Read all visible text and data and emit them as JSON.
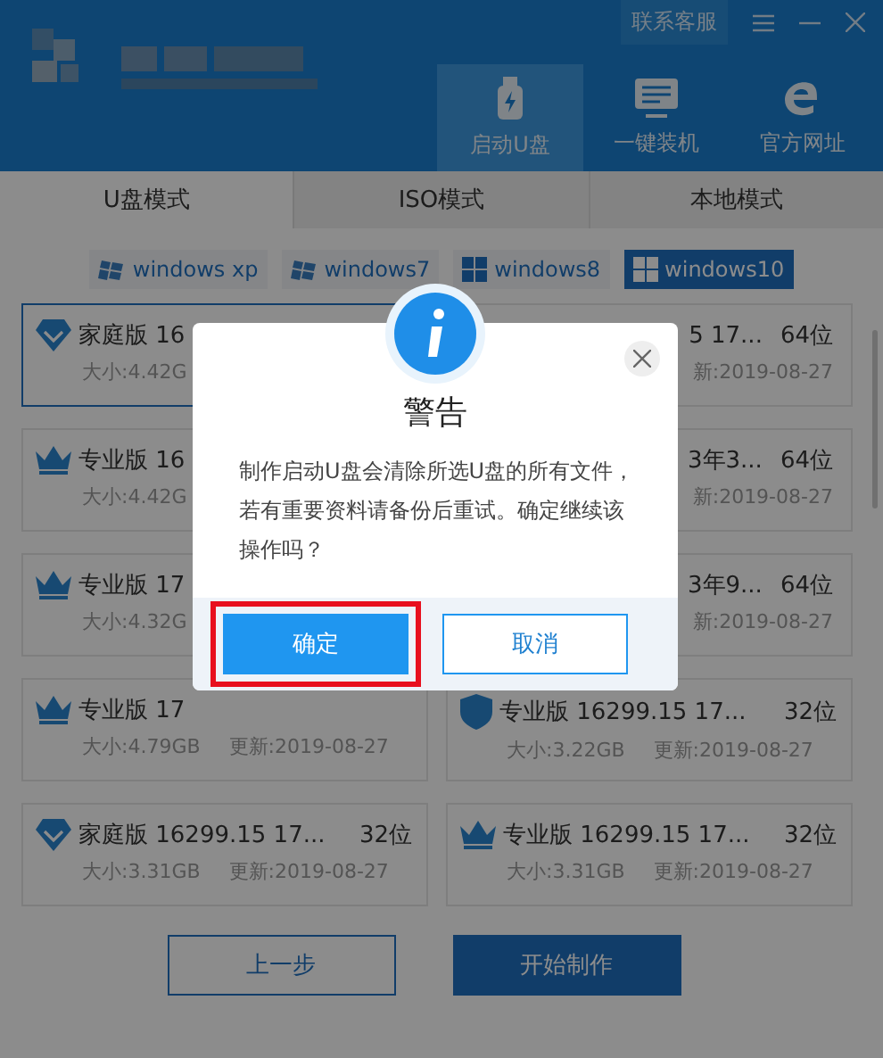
{
  "header": {
    "service_button": "联系客服",
    "toolbar": [
      {
        "kind": "usb",
        "label": "启动U盘",
        "selected": true
      },
      {
        "kind": "monitor",
        "label": "一键装机",
        "selected": false
      },
      {
        "kind": "browser",
        "label": "官方网址",
        "selected": false
      }
    ]
  },
  "tabs": [
    {
      "label": "U盘模式",
      "selected": true
    },
    {
      "label": "ISO模式",
      "selected": false
    },
    {
      "label": "本地模式",
      "selected": false
    }
  ],
  "os_buttons": [
    {
      "kind": "flag",
      "label": "windows xp",
      "selected": false
    },
    {
      "kind": "flag",
      "label": "windows7",
      "selected": false
    },
    {
      "kind": "tiles",
      "label": "windows8",
      "selected": false
    },
    {
      "kind": "tiles",
      "label": "windows10",
      "selected": true
    }
  ],
  "cards": [
    {
      "kind": "home",
      "title": "家庭版 16",
      "size": "大小:4.42G",
      "selected": true
    },
    {
      "kind": "covered",
      "title": "5 17...",
      "bits": "64位",
      "date": "新:2019-08-27",
      "selected": false
    },
    {
      "kind": "pro",
      "title": "专业版 16",
      "size": "大小:4.42G",
      "selected": false
    },
    {
      "kind": "covered",
      "title": "3年3...",
      "bits": "64位",
      "date": "新:2019-08-27",
      "selected": false
    },
    {
      "kind": "pro",
      "title": "专业版 17",
      "size": "大小:4.32G",
      "selected": false
    },
    {
      "kind": "covered",
      "title": "3年9...",
      "bits": "64位",
      "date": "新:2019-08-27",
      "selected": false
    },
    {
      "kind": "pro",
      "title": "专业版 17",
      "size": "大小:4.79GB",
      "date": "更新:2019-08-27",
      "selected": false
    },
    {
      "kind": "enterprise",
      "title": "专业版 16299.15 17...",
      "bits": "32位",
      "size": "大小:3.22GB",
      "date": "更新:2019-08-27",
      "selected": false
    },
    {
      "kind": "home",
      "title": "家庭版 16299.15 17...",
      "bits": "32位",
      "size": "大小:3.31GB",
      "date": "更新:2019-08-27",
      "selected": false
    },
    {
      "kind": "pro",
      "title": "专业版 16299.15 17...",
      "bits": "32位",
      "size": "大小:3.31GB",
      "date": "更新:2019-08-27",
      "selected": false
    }
  ],
  "buttons": {
    "back": "上一步",
    "start": "开始制作"
  },
  "dialog": {
    "title": "警告",
    "message": "制作启动U盘会清除所选U盘的所有文件，若有重要资料请备份后重试。确定继续该操作吗？",
    "confirm": "确定",
    "cancel": "取消",
    "confirm_highlighted": true
  }
}
